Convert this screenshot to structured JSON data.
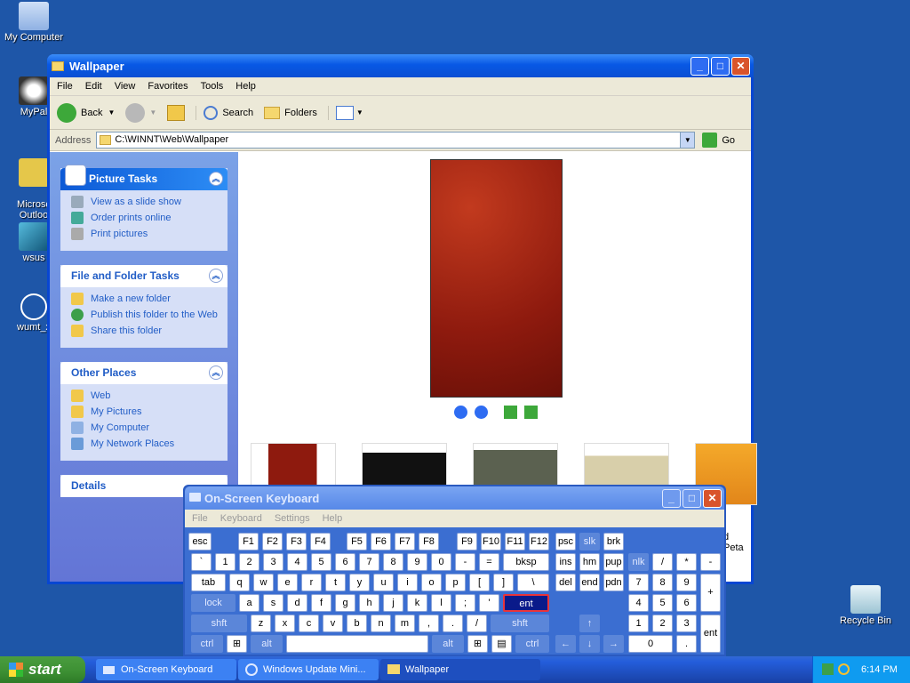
{
  "desktop": {
    "icons": [
      {
        "label": "My Computer"
      },
      {
        "label": "MyPal"
      },
      {
        "label": "Microsc\nOutloo"
      },
      {
        "label": "wsus"
      },
      {
        "label": "wumt_x"
      }
    ],
    "recycle_bin": "Recycle Bin"
  },
  "window": {
    "title": "Wallpaper",
    "menu": [
      "File",
      "Edit",
      "View",
      "Favorites",
      "Tools",
      "Help"
    ],
    "toolbar": {
      "back": "Back",
      "search": "Search",
      "folders": "Folders"
    },
    "address_label": "Address",
    "address_value": "C:\\WINNT\\Web\\Wallpaper",
    "go_label": "Go"
  },
  "sidebar": {
    "picture_tasks": {
      "title": "Picture Tasks",
      "items": [
        "View as a slide show",
        "Order prints online",
        "Print pictures"
      ]
    },
    "file_folder_tasks": {
      "title": "File and Folder Tasks",
      "items": [
        "Make a new folder",
        "Publish this folder to the Web",
        "Share this folder"
      ]
    },
    "other_places": {
      "title": "Other Places",
      "items": [
        "Web",
        "My Pictures",
        "My Computer",
        "My Network Places"
      ]
    },
    "details": {
      "title": "Details"
    }
  },
  "filmstrip_partial_label": "d Peta",
  "osk": {
    "title": "On-Screen Keyboard",
    "menu": [
      "File",
      "Keyboard",
      "Settings",
      "Help"
    ]
  },
  "taskbar": {
    "start": "start",
    "buttons": [
      "On-Screen Keyboard",
      "Windows Update Mini...",
      "Wallpaper"
    ],
    "clock": "6:14 PM"
  },
  "colors": {
    "xp_blue": "#0a4fd3",
    "desktop": "#1e56a8",
    "selected_key": "#0a1a8a"
  }
}
